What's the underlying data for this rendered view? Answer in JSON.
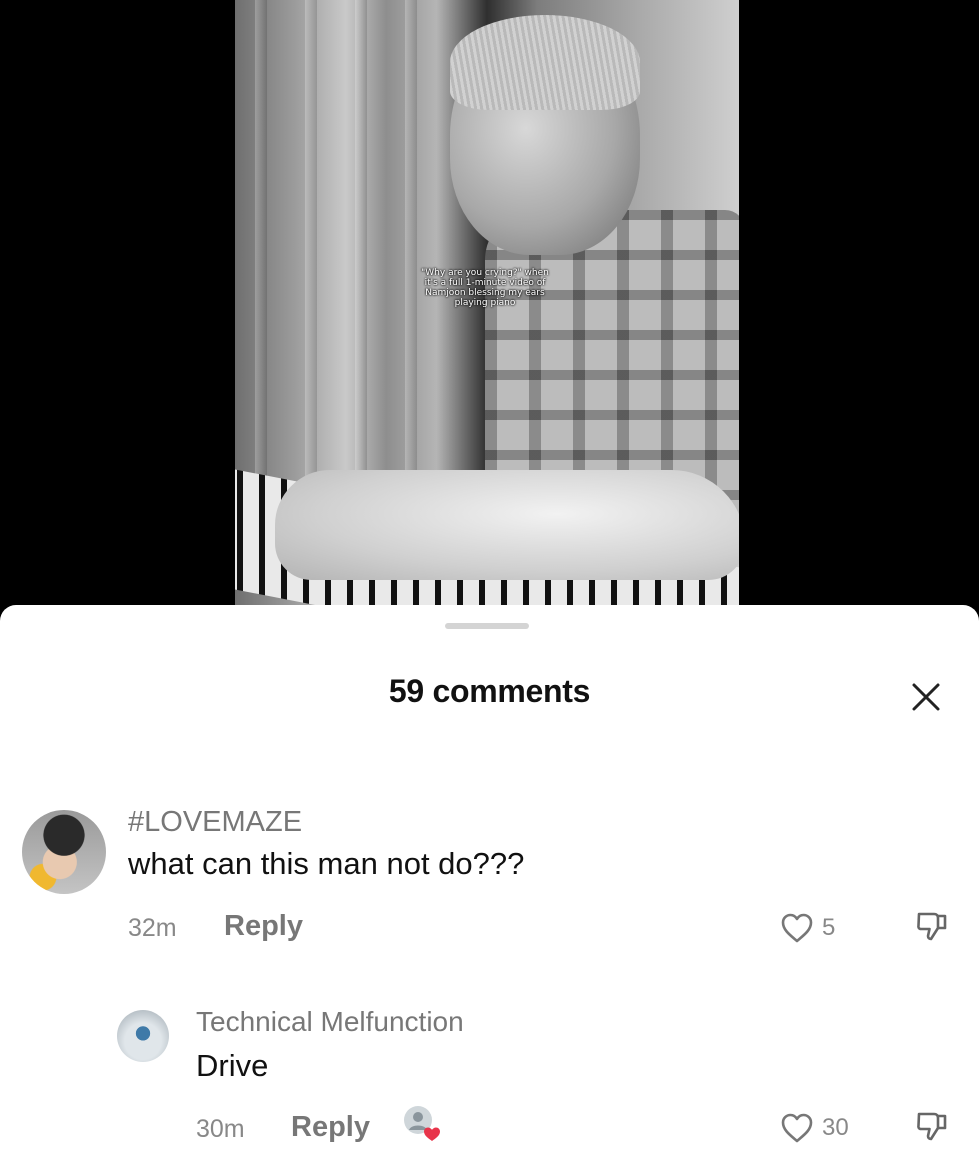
{
  "video": {
    "caption_lines": [
      "\"Why are you crying?\" when",
      "it's a full 1-minute video of",
      "Namjoon blessing my ears",
      "playing piano"
    ]
  },
  "sheet": {
    "title": "59 comments",
    "close_icon": "close-icon"
  },
  "comments": [
    {
      "username": "#LOVEMAZE",
      "text": "what can this man not do???",
      "time": "32m",
      "reply_label": "Reply",
      "likes": "5",
      "icons": [
        "heart-icon",
        "dislike-icon"
      ]
    },
    {
      "username": "Technical Melfunction",
      "text": "Drive",
      "time": "30m",
      "reply_label": "Reply",
      "likes": "30",
      "icons": [
        "creator-liked-icon",
        "heart-icon",
        "dislike-icon"
      ]
    }
  ],
  "colors": {
    "sheet_bg": "#ffffff",
    "like_heart_accent": "#e8344a",
    "muted_text": "#888888",
    "primary_text": "#111111"
  }
}
